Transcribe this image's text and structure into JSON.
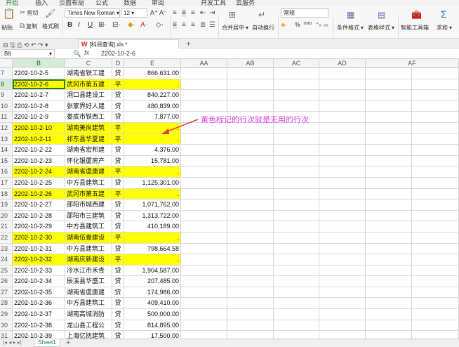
{
  "menu": [
    "开始",
    "插入",
    "页面布局",
    "公式",
    "数据",
    "审阅",
    "开发工具",
    "云服务"
  ],
  "ribbon": {
    "paste": "粘贴",
    "cut": "剪切",
    "copy": "复制",
    "format_painter": "格式刷",
    "font_name": "Times New Roman",
    "font_size": "12",
    "number_format": "常规",
    "merge_center": "合并居中",
    "wrap_text": "自动换行",
    "conditional_format": "条件格式",
    "table_style": "表格样式",
    "smart_toolbox": "智能工具箱",
    "sum": "求和"
  },
  "doc_tab": "[科目查询].xls *",
  "name_box": "B8",
  "formula": "2202-10-2-6",
  "columns": [
    "B",
    "C",
    "D",
    "E",
    "AA",
    "AB",
    "AC",
    "AD",
    "AF"
  ],
  "rows": [
    {
      "num": "7",
      "b": "2202-10-2-5",
      "c": "湖南省铁工建",
      "d": "贷",
      "e": "866,631.00",
      "hl": false
    },
    {
      "num": "8",
      "b": "2202-10-2-6",
      "c": "武冈市第五建",
      "d": "平",
      "e": ".",
      "hl": true
    },
    {
      "num": "9",
      "b": "2202-10-2-7",
      "c": "洞口县建设工",
      "d": "贷",
      "e": "840,227.00",
      "hl": false
    },
    {
      "num": "10",
      "b": "2202-10-2-8",
      "c": "张家界好人建",
      "d": "贷",
      "e": "480,839.00",
      "hl": false
    },
    {
      "num": "11",
      "b": "2202-10-2-9",
      "c": "娄底市铁西工",
      "d": "贷",
      "e": "7,877.00",
      "hl": false
    },
    {
      "num": "12",
      "b": "2202-10-2-10",
      "c": "湖南美尚建筑",
      "d": "平",
      "e": ".",
      "hl": true
    },
    {
      "num": "13",
      "b": "2202-10-2-11",
      "c": "祁东县华夏建",
      "d": "平",
      "e": ".",
      "hl": true
    },
    {
      "num": "14",
      "b": "2202-10-2-22",
      "c": "湖南省宏邦建",
      "d": "贷",
      "e": "4,376.00",
      "hl": false
    },
    {
      "num": "15",
      "b": "2202-10-2-23",
      "c": "怀化银厦房产",
      "d": "贷",
      "e": "15,781.00",
      "hl": false
    },
    {
      "num": "16",
      "b": "2202-10-2-24",
      "c": "湖南省虞唐建",
      "d": "平",
      "e": ".",
      "hl": true
    },
    {
      "num": "17",
      "b": "2202-10-2-25",
      "c": "中方县建筑工",
      "d": "贷",
      "e": "1,125,301.00",
      "hl": false
    },
    {
      "num": "18",
      "b": "2202-10-2-26",
      "c": "武冈市第五建",
      "d": "平",
      "e": ".",
      "hl": true
    },
    {
      "num": "19",
      "b": "2202-10-2-27",
      "c": "邵阳市城西建",
      "d": "贷",
      "e": "1,071,762.00",
      "hl": false
    },
    {
      "num": "20",
      "b": "2202-10-2-28",
      "c": "邵阳市三建筑",
      "d": "贷",
      "e": "1,313,722.00",
      "hl": false
    },
    {
      "num": "21",
      "b": "2202-10-2-29",
      "c": "中方县建筑工",
      "d": "贷",
      "e": "410,189.00",
      "hl": false
    },
    {
      "num": "22",
      "b": "2202-10-2-30",
      "c": "湖南伍壹建设",
      "d": "平",
      "e": ".",
      "hl": true
    },
    {
      "num": "23",
      "b": "2202-10-2-31",
      "c": "中方县建筑工",
      "d": "贷",
      "e": "798,664.58",
      "hl": false
    },
    {
      "num": "24",
      "b": "2202-10-2-32",
      "c": "湖南庆新建设",
      "d": "平",
      "e": ".",
      "hl": true
    },
    {
      "num": "25",
      "b": "2202-10-2-33",
      "c": "冷水江市禾青",
      "d": "贷",
      "e": "1,904,587.00",
      "hl": false
    },
    {
      "num": "26",
      "b": "2202-10-2-34",
      "c": "辰溪县华盛工",
      "d": "贷",
      "e": "207,485.00",
      "hl": false
    },
    {
      "num": "27",
      "b": "2202-10-2-35",
      "c": "湖南省虞唐建",
      "d": "贷",
      "e": "174,986.00",
      "hl": false
    },
    {
      "num": "28",
      "b": "2202-10-2-36",
      "c": "中方县建筑工",
      "d": "贷",
      "e": "409,410.00",
      "hl": false
    },
    {
      "num": "29",
      "b": "2202-10-2-37",
      "c": "湖南高城消防",
      "d": "贷",
      "e": "500,000.00",
      "hl": false
    },
    {
      "num": "30",
      "b": "2202-10-2-38",
      "c": "龙山县工程公",
      "d": "贷",
      "e": "814,895.00",
      "hl": false
    },
    {
      "num": "31",
      "b": "2202-10-2-39",
      "c": "上海亿抚建筑",
      "d": "贷",
      "e": "17,500.00",
      "hl": false
    }
  ],
  "annotation": "黄色标记的行次就是无用的行次",
  "sheet_tab": "Sheet1",
  "colors": {
    "highlight": "#ffff00",
    "annotation": "#e23ce2",
    "accent": "#1a8a3a"
  }
}
